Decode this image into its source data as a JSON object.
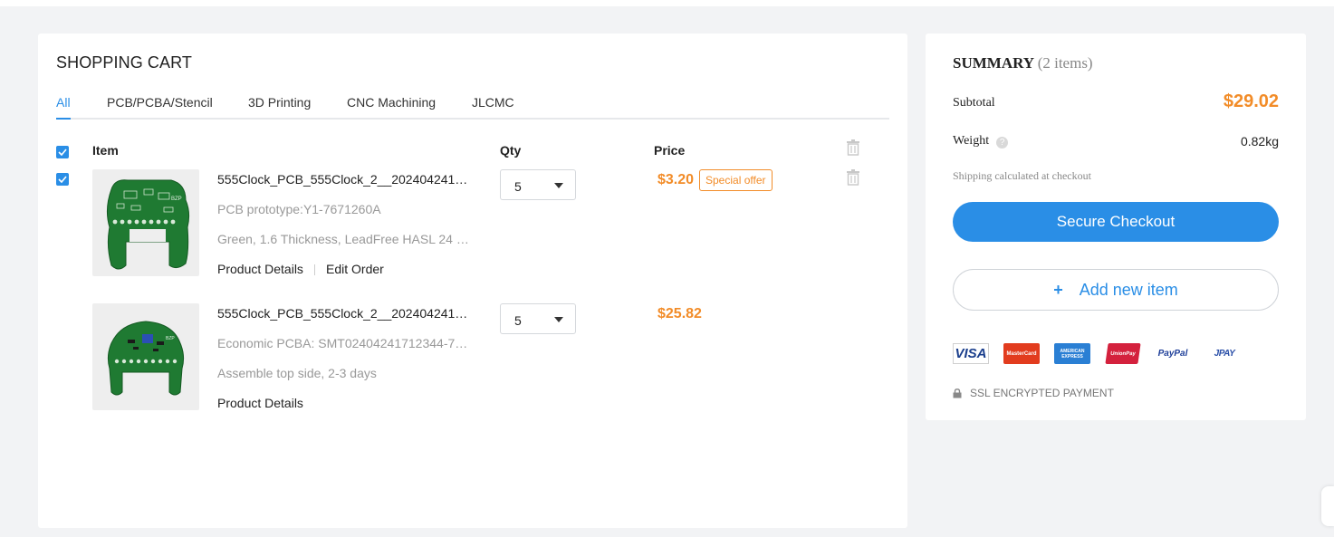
{
  "cart": {
    "title": "SHOPPING CART",
    "tabs": [
      {
        "label": "All",
        "active": true
      },
      {
        "label": "PCB/PCBA/Stencil",
        "active": false
      },
      {
        "label": "3D Printing",
        "active": false
      },
      {
        "label": "CNC Machining",
        "active": false
      },
      {
        "label": "JLCMC",
        "active": false
      }
    ],
    "headers": {
      "item": "Item",
      "qty": "Qty",
      "price": "Price"
    },
    "items": [
      {
        "name": "555Clock_PCB_555Clock_2__202404241…",
        "line1": "PCB prototype:Y1-7671260A",
        "line2": "Green, 1.6 Thickness, LeadFree HASL 24 …",
        "links": [
          "Product Details",
          "Edit Order"
        ],
        "qty": "5",
        "price": "$3.20",
        "badge": "Special offer",
        "checked": true
      },
      {
        "name": "555Clock_PCB_555Clock_2__202404241…",
        "line1": "Economic PCBA: SMT02404241712344-7…",
        "line2": "Assemble top side, 2-3 days",
        "links": [
          "Product Details"
        ],
        "qty": "5",
        "price": "$25.82"
      }
    ]
  },
  "summary": {
    "title": "SUMMARY",
    "count": "(2 items)",
    "subtotal_label": "Subtotal",
    "subtotal": "$29.02",
    "weight_label": "Weight",
    "weight": "0.82kg",
    "shipping_note": "Shipping calculated at checkout",
    "checkout_label": "Secure Checkout",
    "add_plus": "+",
    "add_label": "Add new item",
    "payment_methods": [
      "VISA",
      "MasterCard",
      "AMERICAN EXPRESS",
      "UnionPay",
      "PayPal",
      "JPAY"
    ],
    "ssl_text": "SSL ENCRYPTED PAYMENT"
  },
  "colors": {
    "accent": "#2a8ee6",
    "price": "#f28c28",
    "pcb_green": "#1f7a32"
  }
}
